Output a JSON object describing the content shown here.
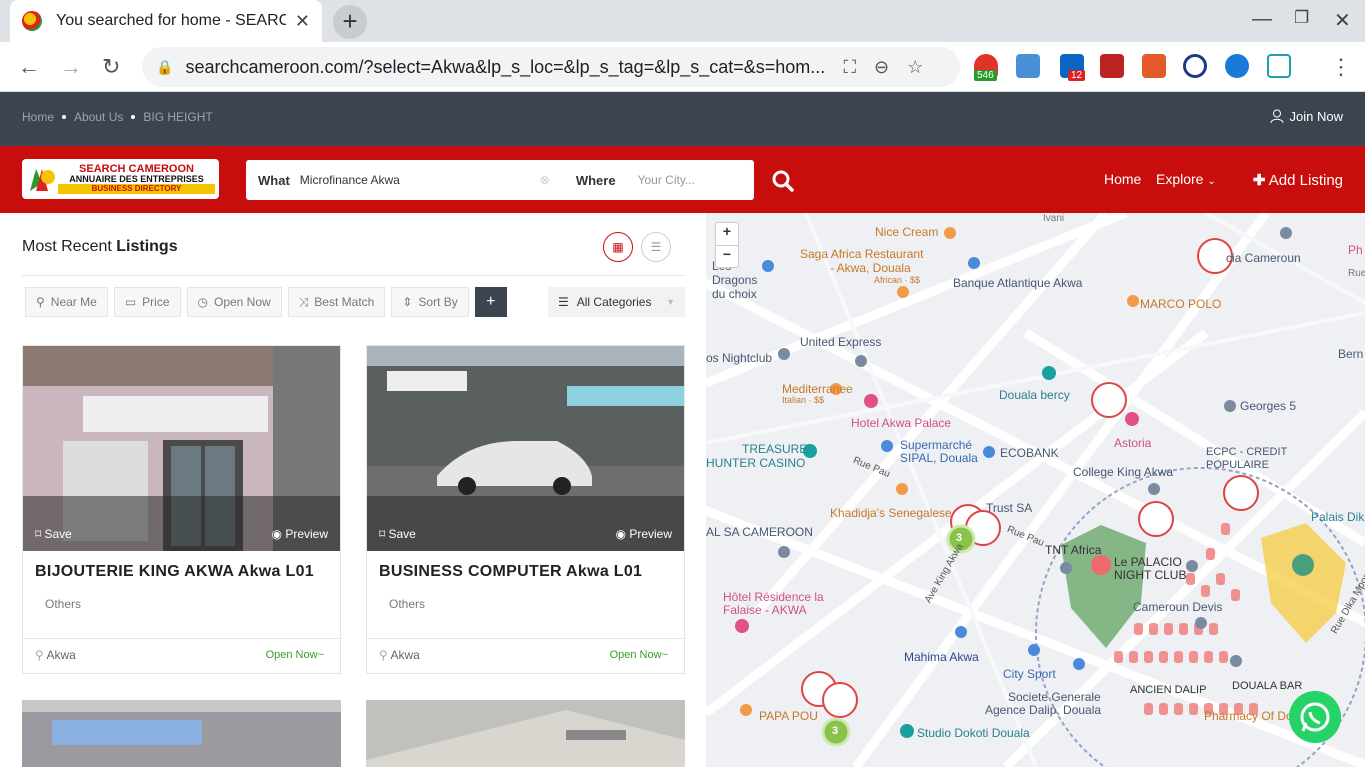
{
  "browser": {
    "tab_title": "You searched for home - SEARCH CAMEROON",
    "url": "searchcameroon.com/?select=Akwa&lp_s_loc=&lp_s_tag=&lp_s_cat=&s=hom...",
    "ext_badge_1": "546",
    "ext_badge_2": "12"
  },
  "topbar": {
    "links": [
      "Home",
      "About Us",
      "BIG HEIGHT"
    ],
    "join": "Join Now"
  },
  "header": {
    "logo_line1": "SEARCH CAMEROON",
    "logo_line2": "ANNUAIRE DES ENTREPRISES",
    "logo_line3": "BUSINESS DIRECTORY",
    "what_label": "What",
    "what_value": "Microfinance Akwa",
    "where_label": "Where",
    "where_placeholder": "Your City...",
    "nav_home": "Home",
    "nav_explore": "Explore",
    "add_listing": "Add Listing"
  },
  "listings": {
    "heading_pre": "Most Recent",
    "heading_bold": "Listings",
    "filters": [
      "Near Me",
      "Price",
      "Open Now",
      "Best Match",
      "Sort By"
    ],
    "category": "All Categories",
    "cards": [
      {
        "title": "BIJOUTERIE KING AKWA Akwa L01",
        "category": "Others",
        "location": "Akwa",
        "status": "Open Now~",
        "save": "Save",
        "preview": "Preview"
      },
      {
        "title": "BUSINESS COMPUTER Akwa L01",
        "category": "Others",
        "location": "Akwa",
        "status": "Open Now~",
        "save": "Save",
        "preview": "Preview"
      }
    ]
  },
  "map": {
    "labels": [
      "Nice Cream",
      "Saga Africa Restaurant",
      "- Akwa, Douala",
      "African · $$",
      "Banque Atlantique Akwa",
      "Les Dragons du choix",
      "cia Cameroun",
      "MARCO POLO",
      "United Express",
      "os Nightclub",
      "Mediterranee",
      "Italian · $$",
      "Douala bercy",
      "Georges 5",
      "Hotel Akwa Palace",
      "Astoria",
      "TREASURE",
      "HUNTER CASINO",
      "Supermarché",
      "SIPAL, Douala",
      "ECOBANK",
      "College King Akwa",
      "ECPC - CREDIT",
      "POPULAIRE",
      "Khadidja's Senegalese",
      "Trust SA",
      "AL SA CAMEROON",
      "TNT Africa",
      "Le PALACIO",
      "NIGHT CLUB",
      "Palais Dika",
      "Cameroun Devis",
      "Hôtel Résidence la",
      "Falaise - AKWA",
      "Mahima Akwa",
      "City Sport",
      "Societe Generale",
      "Agence Dalip, Douala",
      "ANCIEN DALIP",
      "DOUALA BAR",
      "Pharmacy Of Doua",
      "PAPA POU",
      "Studio Dokoti Douala",
      "Rue Pau",
      "Rue Pau",
      "Ave King Akwa",
      "Rue Dika Mpondo",
      "Bern",
      "Ivani",
      "Ph",
      "Rue"
    ],
    "cluster_1": "3",
    "cluster_2": "3",
    "zoom_in": "+",
    "zoom_out": "−"
  }
}
